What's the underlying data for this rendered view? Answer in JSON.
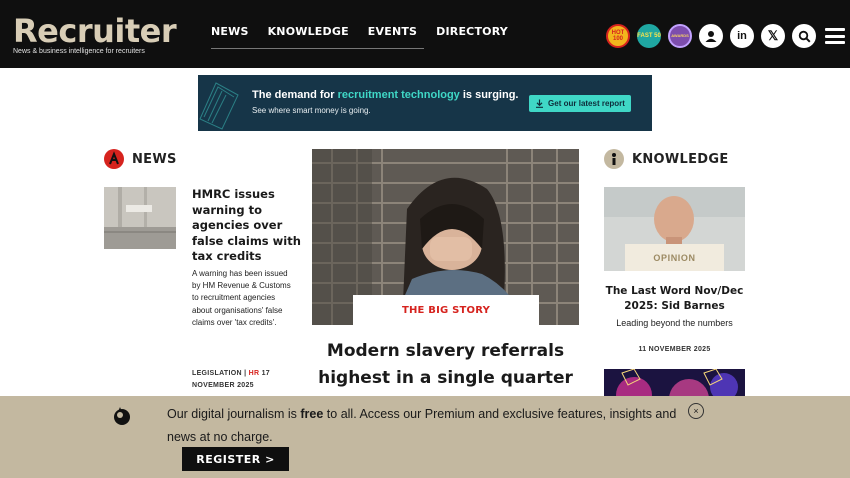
{
  "header": {
    "logo": "Recruiter",
    "tagline": "News & business intelligence for recruiters",
    "nav": [
      "NEWS",
      "KNOWLEDGE",
      "EVENTS",
      "DIRECTORY"
    ],
    "badges": {
      "hot": "HOT 100",
      "fast": "FAST 50",
      "award": "AWARDS"
    },
    "icons": [
      "user-icon",
      "linkedin-icon",
      "x-icon",
      "search-icon",
      "menu-icon"
    ]
  },
  "ad": {
    "line1_pre": "The demand for ",
    "line1_highlight": "recruitment technology",
    "line1_post": " is surging.",
    "line2": "See where smart money is going.",
    "button": "Get our latest report"
  },
  "news": {
    "section_title": "NEWS",
    "headline": "HMRC issues warning to agencies over false claims with tax credits",
    "summary": "A warning has been issued by HM Revenue & Customs to recruitment agencies about organisations' false claims over 'tax credits'.",
    "category": "LEGISLATION",
    "separator": "|",
    "tag": "HR",
    "date": "17 NOVEMBER 2025"
  },
  "big_story": {
    "label": "THE BIG STORY",
    "headline": "Modern slavery referrals highest in a single quarter"
  },
  "knowledge": {
    "section_title": "KNOWLEDGE",
    "label": "OPINION",
    "title": "The Last Word Nov/Dec 2025: Sid Barnes",
    "subtitle": "Leading beyond the numbers",
    "date": "11 NOVEMBER 2025"
  },
  "register": {
    "text_pre": "Our digital journalism is ",
    "text_bold": "free",
    "text_post": " to all. Access our Premium and exclusive features, insights and news at no charge.",
    "button": "REGISTER >",
    "close": "×"
  },
  "colors": {
    "accent_red": "#d6231e",
    "teal": "#3fd7c6",
    "beige": "#c3b8a0"
  }
}
